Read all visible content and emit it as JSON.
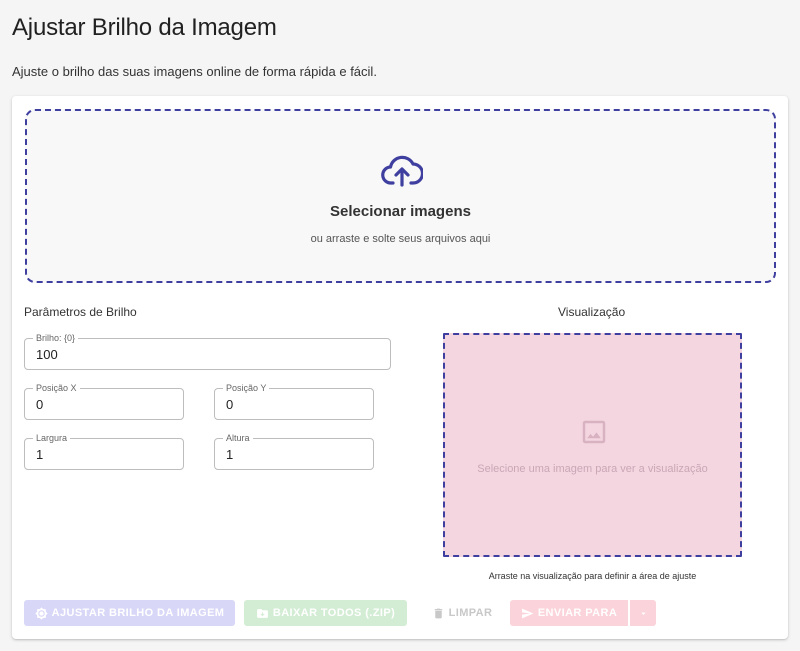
{
  "page": {
    "title": "Ajustar Brilho da Imagem",
    "subtitle": "Ajuste o brilho das suas imagens online de forma rápida e fácil."
  },
  "dropzone": {
    "icon": "cloud-upload-icon",
    "title": "Selecionar imagens",
    "hint": "ou arraste e solte seus arquivos aqui"
  },
  "params": {
    "title": "Parâmetros de Brilho",
    "brightness": {
      "label": "Brilho: {0}",
      "value": "100"
    },
    "pos_x": {
      "label": "Posição X",
      "value": "0"
    },
    "pos_y": {
      "label": "Posição Y",
      "value": "0"
    },
    "width": {
      "label": "Largura",
      "value": "1"
    },
    "height": {
      "label": "Altura",
      "value": "1"
    }
  },
  "preview": {
    "title": "Visualização",
    "icon": "image-icon",
    "placeholder": "Selecione uma imagem para ver a visualização",
    "note": "Arraste na visualização para definir a área de ajuste"
  },
  "actions": {
    "adjust_label": "Ajustar Brilho da Imagem",
    "download_label": "Baixar Todos (.ZIP)",
    "clear_label": "Limpar",
    "send_label": "Enviar Para"
  },
  "colors": {
    "accent": "#3f3fa0",
    "preview_bg": "#f4d6e1",
    "adjust_btn": "#d8d7f7",
    "download_btn": "#d3ecd4",
    "send_btn": "#fbd3da"
  }
}
